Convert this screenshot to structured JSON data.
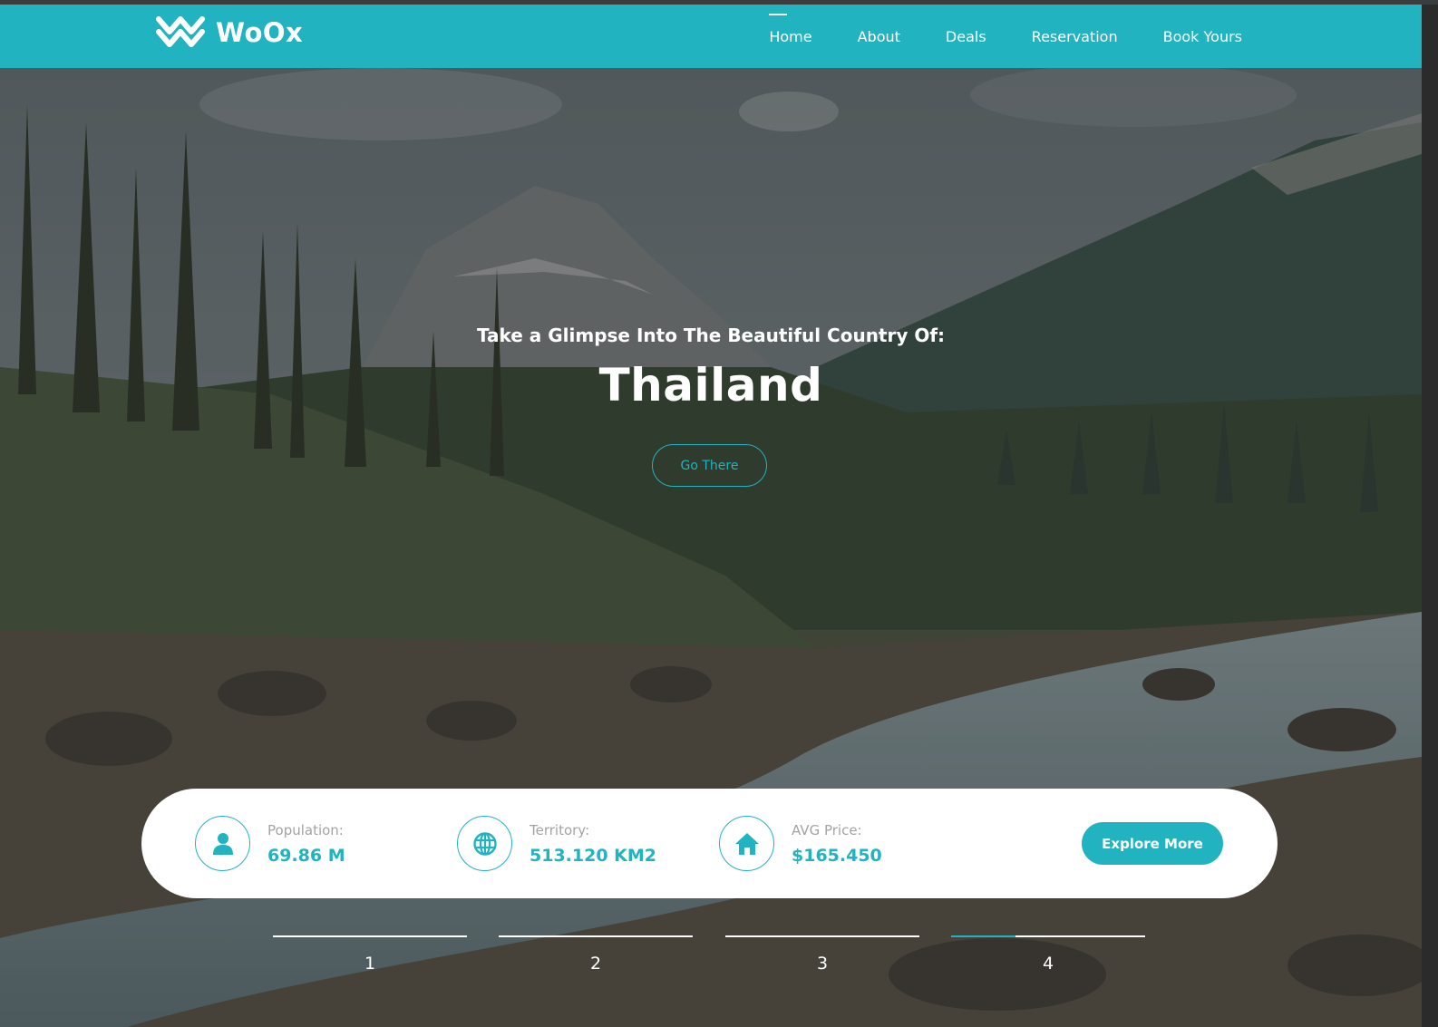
{
  "brand": {
    "name": "WoOx",
    "logo": "woox-logo-icon"
  },
  "nav": {
    "items": [
      {
        "label": "Home",
        "active": true
      },
      {
        "label": "About",
        "active": false
      },
      {
        "label": "Deals",
        "active": false
      },
      {
        "label": "Reservation",
        "active": false
      },
      {
        "label": "Book Yours",
        "active": false
      }
    ]
  },
  "hero": {
    "subtitle": "Take a Glimpse Into The Beautiful Country Of:",
    "title": "Thailand",
    "cta_label": "Go There"
  },
  "stats": [
    {
      "icon": "person-icon",
      "label": "Population:",
      "value": "69.86 M"
    },
    {
      "icon": "globe-icon",
      "label": "Territory:",
      "value": "513.120 KM2"
    },
    {
      "icon": "home-icon",
      "label": "AVG Price:",
      "value": "$165.450"
    }
  ],
  "explore_label": "Explore More",
  "pager": {
    "items": [
      "1",
      "2",
      "3",
      "4"
    ],
    "active_index": 3,
    "active_progress": 0.33
  },
  "colors": {
    "accent": "#22b3c1",
    "white": "#ffffff",
    "label_gray": "#a3a3a3"
  }
}
